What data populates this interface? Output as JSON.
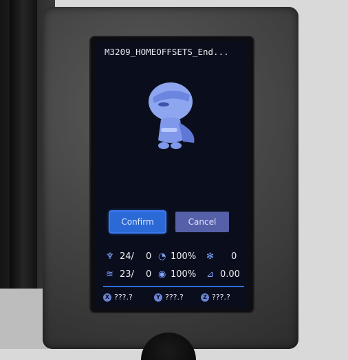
{
  "screen": {
    "title": "M3209_HOMEOFFSETS_End...",
    "confirm_label": "Confirm",
    "cancel_label": "Cancel"
  },
  "status": {
    "nozzle_temp": "24/",
    "nozzle_target": "0",
    "speed": "100%",
    "fan": "0",
    "bed_temp": "23/",
    "bed_target": "0",
    "flow": "100%",
    "z_offset": "0.00"
  },
  "axes": {
    "x_label": "X",
    "x_value": "???.?",
    "y_label": "Y",
    "y_value": "???.?",
    "z_label": "Z",
    "z_value": "???.?"
  },
  "icons": [
    "nozzle-icon",
    "speed-icon",
    "fan-icon",
    "bed-icon",
    "flow-icon",
    "z-offset-icon"
  ],
  "colors": {
    "accent": "#2b6ad6",
    "cancel": "#5660a8",
    "screen_bg": "#0a0e1c"
  }
}
